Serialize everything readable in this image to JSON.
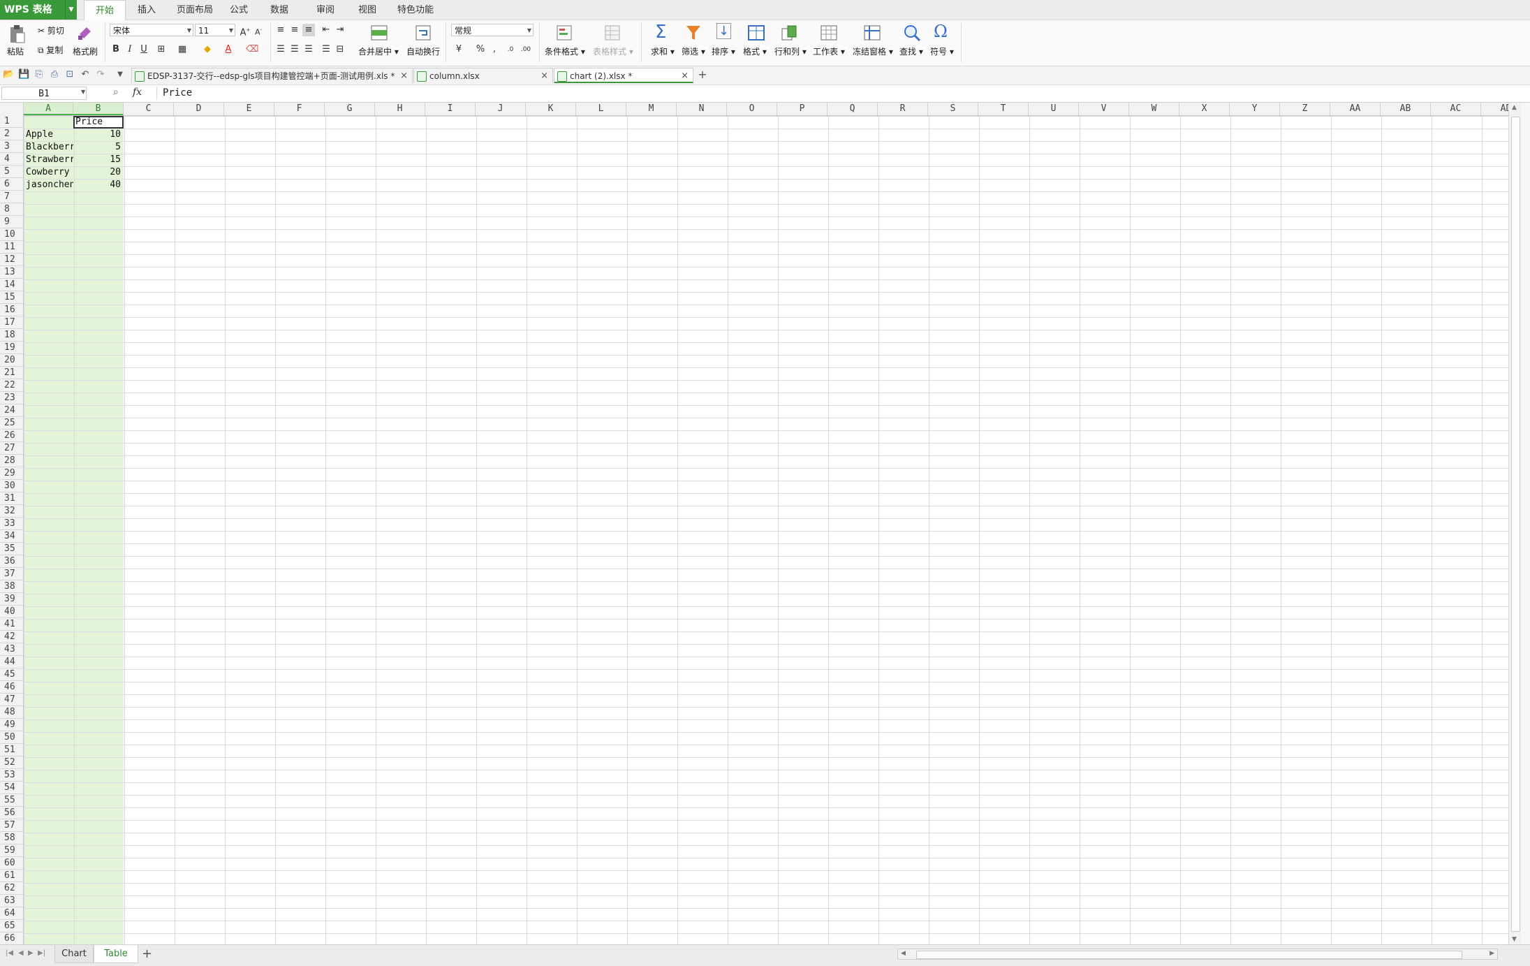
{
  "app": {
    "name": "WPS 表格",
    "accent": "#3a9a3a"
  },
  "menu": {
    "tabs": [
      "开始",
      "插入",
      "页面布局",
      "公式",
      "数据",
      "审阅",
      "视图",
      "特色功能"
    ],
    "active": "开始"
  },
  "ribbon": {
    "paste": "粘贴",
    "cut": "剪切",
    "copy": "复制",
    "format_painter": "格式刷",
    "font_name": "宋体",
    "font_size": "11",
    "merge_center": "合并居中",
    "wrap_text": "自动换行",
    "number_format": "常规",
    "conditional_format": "条件格式",
    "table_style": "表格样式",
    "sum": "求和",
    "filter": "筛选",
    "sort": "排序",
    "format": "格式",
    "rows_cols": "行和列",
    "worksheet": "工作表",
    "freeze": "冻结窗格",
    "find": "查找",
    "symbol": "符号"
  },
  "documents": [
    {
      "name": "EDSP-3137-交行--edsp-gls项目构建管控端+页面-测试用例.xls *",
      "active": false
    },
    {
      "name": "column.xlsx",
      "active": false
    },
    {
      "name": "chart (2).xlsx *",
      "active": true
    }
  ],
  "formula_bar": {
    "cell_ref": "B1",
    "fx": "fx",
    "content": "Price"
  },
  "columns": [
    "A",
    "B",
    "C",
    "D",
    "E",
    "F",
    "G",
    "H",
    "I",
    "J",
    "K",
    "L",
    "M",
    "N",
    "O",
    "P",
    "Q",
    "R",
    "S",
    "T",
    "U",
    "V",
    "W",
    "X",
    "Y",
    "Z",
    "AA",
    "AB",
    "AC",
    "AD"
  ],
  "rows_shown": 66,
  "table": {
    "header": {
      "A": "",
      "B": "Price"
    },
    "rows": [
      {
        "A": "Apple",
        "B": "10"
      },
      {
        "A": "Blackberry",
        "B": "5"
      },
      {
        "A": "Strawberry",
        "B": "15"
      },
      {
        "A": "Cowberry",
        "B": "20"
      },
      {
        "A": "jasonchen",
        "B": "40"
      }
    ]
  },
  "sheets": [
    {
      "name": "Chart",
      "active": false
    },
    {
      "name": "Table",
      "active": true
    }
  ]
}
